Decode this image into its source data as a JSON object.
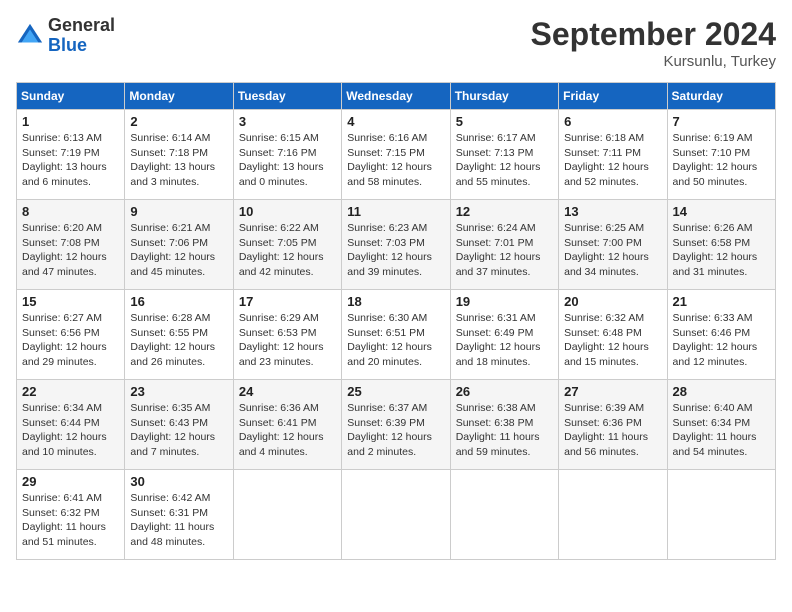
{
  "logo": {
    "general": "General",
    "blue": "Blue"
  },
  "header": {
    "month": "September 2024",
    "location": "Kursunlu, Turkey"
  },
  "weekdays": [
    "Sunday",
    "Monday",
    "Tuesday",
    "Wednesday",
    "Thursday",
    "Friday",
    "Saturday"
  ],
  "weeks": [
    [
      {
        "day": 1,
        "sunrise": "6:13 AM",
        "sunset": "7:19 PM",
        "daylight": "13 hours and 6 minutes."
      },
      {
        "day": 2,
        "sunrise": "6:14 AM",
        "sunset": "7:18 PM",
        "daylight": "13 hours and 3 minutes."
      },
      {
        "day": 3,
        "sunrise": "6:15 AM",
        "sunset": "7:16 PM",
        "daylight": "13 hours and 0 minutes."
      },
      {
        "day": 4,
        "sunrise": "6:16 AM",
        "sunset": "7:15 PM",
        "daylight": "12 hours and 58 minutes."
      },
      {
        "day": 5,
        "sunrise": "6:17 AM",
        "sunset": "7:13 PM",
        "daylight": "12 hours and 55 minutes."
      },
      {
        "day": 6,
        "sunrise": "6:18 AM",
        "sunset": "7:11 PM",
        "daylight": "12 hours and 52 minutes."
      },
      {
        "day": 7,
        "sunrise": "6:19 AM",
        "sunset": "7:10 PM",
        "daylight": "12 hours and 50 minutes."
      }
    ],
    [
      {
        "day": 8,
        "sunrise": "6:20 AM",
        "sunset": "7:08 PM",
        "daylight": "12 hours and 47 minutes."
      },
      {
        "day": 9,
        "sunrise": "6:21 AM",
        "sunset": "7:06 PM",
        "daylight": "12 hours and 45 minutes."
      },
      {
        "day": 10,
        "sunrise": "6:22 AM",
        "sunset": "7:05 PM",
        "daylight": "12 hours and 42 minutes."
      },
      {
        "day": 11,
        "sunrise": "6:23 AM",
        "sunset": "7:03 PM",
        "daylight": "12 hours and 39 minutes."
      },
      {
        "day": 12,
        "sunrise": "6:24 AM",
        "sunset": "7:01 PM",
        "daylight": "12 hours and 37 minutes."
      },
      {
        "day": 13,
        "sunrise": "6:25 AM",
        "sunset": "7:00 PM",
        "daylight": "12 hours and 34 minutes."
      },
      {
        "day": 14,
        "sunrise": "6:26 AM",
        "sunset": "6:58 PM",
        "daylight": "12 hours and 31 minutes."
      }
    ],
    [
      {
        "day": 15,
        "sunrise": "6:27 AM",
        "sunset": "6:56 PM",
        "daylight": "12 hours and 29 minutes."
      },
      {
        "day": 16,
        "sunrise": "6:28 AM",
        "sunset": "6:55 PM",
        "daylight": "12 hours and 26 minutes."
      },
      {
        "day": 17,
        "sunrise": "6:29 AM",
        "sunset": "6:53 PM",
        "daylight": "12 hours and 23 minutes."
      },
      {
        "day": 18,
        "sunrise": "6:30 AM",
        "sunset": "6:51 PM",
        "daylight": "12 hours and 20 minutes."
      },
      {
        "day": 19,
        "sunrise": "6:31 AM",
        "sunset": "6:49 PM",
        "daylight": "12 hours and 18 minutes."
      },
      {
        "day": 20,
        "sunrise": "6:32 AM",
        "sunset": "6:48 PM",
        "daylight": "12 hours and 15 minutes."
      },
      {
        "day": 21,
        "sunrise": "6:33 AM",
        "sunset": "6:46 PM",
        "daylight": "12 hours and 12 minutes."
      }
    ],
    [
      {
        "day": 22,
        "sunrise": "6:34 AM",
        "sunset": "6:44 PM",
        "daylight": "12 hours and 10 minutes."
      },
      {
        "day": 23,
        "sunrise": "6:35 AM",
        "sunset": "6:43 PM",
        "daylight": "12 hours and 7 minutes."
      },
      {
        "day": 24,
        "sunrise": "6:36 AM",
        "sunset": "6:41 PM",
        "daylight": "12 hours and 4 minutes."
      },
      {
        "day": 25,
        "sunrise": "6:37 AM",
        "sunset": "6:39 PM",
        "daylight": "12 hours and 2 minutes."
      },
      {
        "day": 26,
        "sunrise": "6:38 AM",
        "sunset": "6:38 PM",
        "daylight": "11 hours and 59 minutes."
      },
      {
        "day": 27,
        "sunrise": "6:39 AM",
        "sunset": "6:36 PM",
        "daylight": "11 hours and 56 minutes."
      },
      {
        "day": 28,
        "sunrise": "6:40 AM",
        "sunset": "6:34 PM",
        "daylight": "11 hours and 54 minutes."
      }
    ],
    [
      {
        "day": 29,
        "sunrise": "6:41 AM",
        "sunset": "6:32 PM",
        "daylight": "11 hours and 51 minutes."
      },
      {
        "day": 30,
        "sunrise": "6:42 AM",
        "sunset": "6:31 PM",
        "daylight": "11 hours and 48 minutes."
      },
      null,
      null,
      null,
      null,
      null
    ]
  ]
}
